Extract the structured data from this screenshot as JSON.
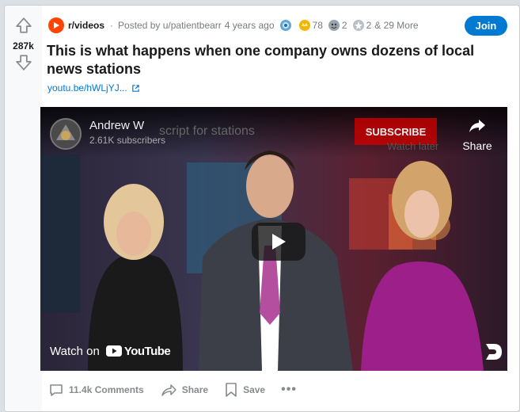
{
  "post": {
    "score": "287k",
    "subreddit": "r/videos",
    "posted_by": "Posted by u/patientbearr",
    "age": "4 years ago",
    "awards": [
      {
        "icon": "helpful-award-icon",
        "count": ""
      },
      {
        "icon": "gold-award-icon",
        "count": "78"
      },
      {
        "icon": "wholesome-award-icon",
        "count": "2"
      },
      {
        "icon": "silver-award-icon",
        "count": "2"
      }
    ],
    "more_awards": "& 29 More",
    "join_label": "Join",
    "title": "This is what happens when one company owns dozens of local news stations",
    "link_text": "youtu.be/hWLjYJ...",
    "brand_color": "#ff4500",
    "join_color": "#0079d3"
  },
  "video": {
    "channel_name": "Andrew W",
    "channel_subs": "2.61K subscribers",
    "title_fragment": "script for stations",
    "subscribe_label": "SUBSCRIBE",
    "watch_later": "Watch later",
    "share_label": "Share",
    "watch_on": "Watch on",
    "youtube_label": "YouTube"
  },
  "actions": {
    "comments": "11.4k Comments",
    "share": "Share",
    "save": "Save",
    "more": "•••"
  }
}
